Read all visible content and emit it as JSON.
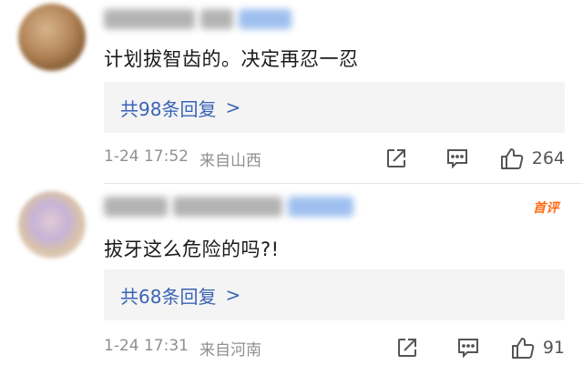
{
  "comments": [
    {
      "text": "计划拔智齿的。决定再忍一忍",
      "replies_label": "共98条回复",
      "time": "1-24 17:52",
      "location": "来自山西",
      "likes": "264"
    },
    {
      "badge": "首评",
      "text": "拔牙这么危险的吗?!",
      "replies_label": "共68条回复",
      "time": "1-24 17:31",
      "location": "来自河南",
      "likes": "91"
    }
  ],
  "icons": {
    "share": "share-external-icon",
    "reply": "comment-bubble-icon",
    "like": "thumbs-up-icon",
    "chevron": ">"
  },
  "colors": {
    "link_blue": "#3a64b6",
    "badge_orange": "#ff6a13",
    "meta_grey": "#8f8f8f",
    "reply_bg": "#f4f4f4"
  }
}
